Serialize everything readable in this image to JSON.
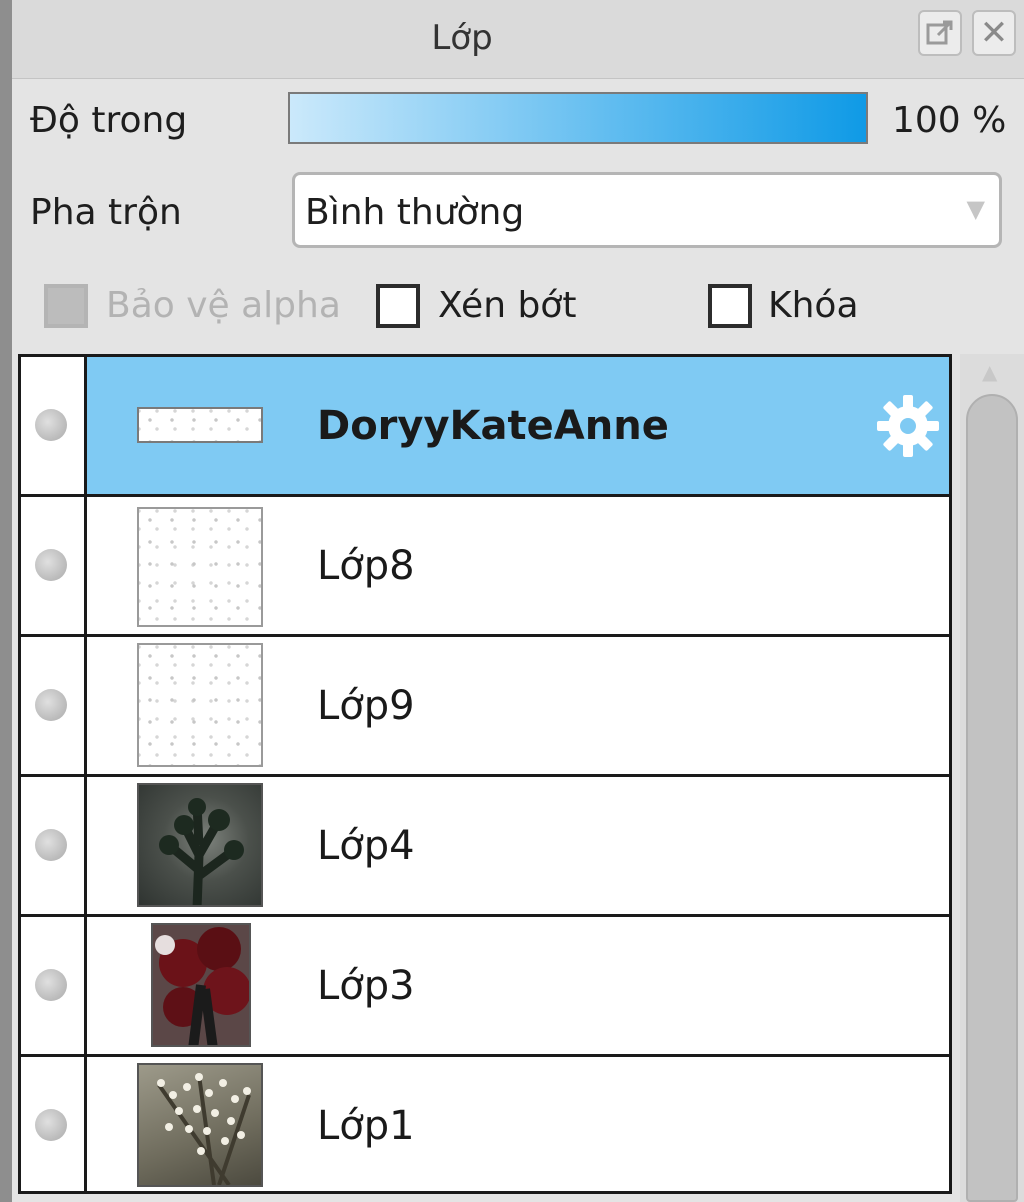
{
  "window": {
    "title": "Lớp"
  },
  "controls": {
    "opacity_label": "Độ trong",
    "opacity_value": "100 %",
    "opacity_fraction": 1.0,
    "blend_label": "Pha trộn",
    "blend_value": "Bình thường"
  },
  "checkboxes": {
    "alpha": {
      "label": "Bảo vệ alpha",
      "checked": false,
      "disabled": true
    },
    "clip": {
      "label": "Xén bớt",
      "checked": false,
      "disabled": false
    },
    "lock": {
      "label": "Khóa",
      "checked": false,
      "disabled": false
    }
  },
  "layers": [
    {
      "name": "DoryyKateAnne",
      "selected": true,
      "bold": true,
      "thumb": "text-strip"
    },
    {
      "name": "Lớp8",
      "selected": false,
      "thumb": "transparent"
    },
    {
      "name": "Lớp9",
      "selected": false,
      "thumb": "transparent"
    },
    {
      "name": "Lớp4",
      "selected": false,
      "thumb": "dark-plant"
    },
    {
      "name": "Lớp3",
      "selected": false,
      "thumb": "red-flower"
    },
    {
      "name": "Lớp1",
      "selected": false,
      "thumb": "baby-breath"
    }
  ],
  "colors": {
    "selected_row": "#7fcaf3",
    "opacity_bar_start": "#cbe9fb",
    "opacity_bar_end": "#0f9ae6"
  },
  "icons": {
    "float": "float-window-icon",
    "close": "close-icon",
    "gear": "gear-icon",
    "dropdown": "chevron-down-icon"
  }
}
